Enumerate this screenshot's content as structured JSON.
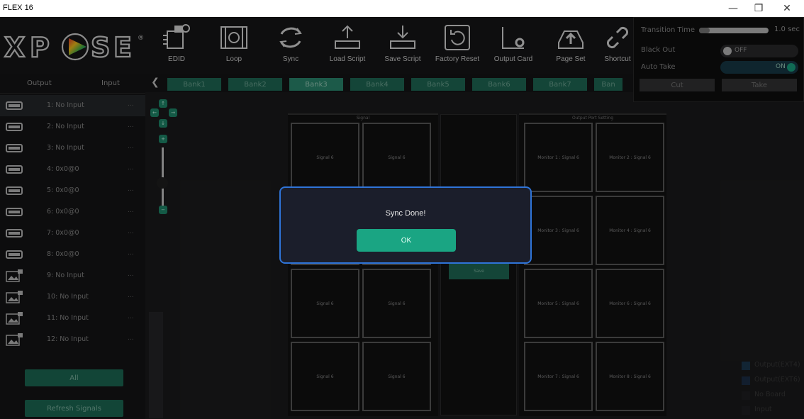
{
  "window": {
    "title": "FLEX 16",
    "minimize": "—",
    "restore": "❐",
    "close": "✕"
  },
  "logo": {
    "text": "XPOSE",
    "mark": "®"
  },
  "toolbar": {
    "items": [
      {
        "label": "EDID",
        "icon": "edid-chip-icon"
      },
      {
        "label": "Loop",
        "icon": "loop-film-icon"
      },
      {
        "label": "Sync",
        "icon": "sync-arrows-icon"
      },
      {
        "label": "Load Script",
        "icon": "load-script-tray-icon"
      },
      {
        "label": "Save Script",
        "icon": "save-script-tray-icon"
      },
      {
        "label": "Factory Reset",
        "icon": "factory-reset-icon"
      },
      {
        "label": "Output Card",
        "icon": "output-card-gear-icon"
      },
      {
        "label": "Page Set",
        "icon": "page-set-upload-icon"
      },
      {
        "label": "Shortcut",
        "icon": "shortcut-link-icon"
      }
    ]
  },
  "control_panel": {
    "transition_time_label": "Transition Time",
    "transition_time_value": "1.0 sec",
    "transition_time_level": 0.15,
    "black_out_label": "Black Out",
    "black_out_state": "OFF",
    "auto_take_label": "Auto Take",
    "auto_take_state": "ON",
    "cut_label": "Cut",
    "take_label": "Take"
  },
  "left_panel": {
    "tabs": [
      "Output",
      "Input"
    ],
    "inputs": [
      {
        "label": "1: No Input",
        "more": "...",
        "icon": "hdmi-port-icon",
        "selected": true
      },
      {
        "label": "2: No Input",
        "more": "...",
        "icon": "hdmi-port-icon"
      },
      {
        "label": "3: No Input",
        "more": "...",
        "icon": "hdmi-port-icon"
      },
      {
        "label": "4: 0x0@0",
        "more": "...",
        "icon": "hdmi-port-icon"
      },
      {
        "label": "5: 0x0@0",
        "more": "...",
        "icon": "hdmi-port-icon"
      },
      {
        "label": "6: 0x0@0",
        "more": "...",
        "icon": "hdmi-port-icon"
      },
      {
        "label": "7: 0x0@0",
        "more": "...",
        "icon": "hdmi-port-icon"
      },
      {
        "label": "8: 0x0@0",
        "more": "...",
        "icon": "hdmi-port-icon"
      },
      {
        "label": "9: No Input",
        "more": "...",
        "icon": "image-input-icon"
      },
      {
        "label": "10: No Input",
        "more": "...",
        "icon": "image-input-icon"
      },
      {
        "label": "11: No Input",
        "more": "...",
        "icon": "image-input-icon"
      },
      {
        "label": "12: No Input",
        "more": "...",
        "icon": "image-input-icon"
      }
    ],
    "all_button": "All",
    "refresh_button": "Refresh Signals"
  },
  "banks": {
    "prev": "❮",
    "items": [
      "Bank1",
      "Bank2",
      "Bank3",
      "Bank4",
      "Bank5",
      "Bank6",
      "Bank7",
      "Ban"
    ],
    "active_index": 2
  },
  "ptz": {
    "up": "↑",
    "left": "←",
    "right": "→",
    "down": "↓",
    "zoom_in": "+",
    "zoom_out": "−"
  },
  "layout": {
    "signal_title": "Signal",
    "output_title": "Output Port Setting",
    "signal_cells": [
      "Signal 6",
      "Signal 6",
      "Signal 6",
      "Signal 6",
      "Signal 6",
      "Signal 6",
      "Signal 6",
      "Signal 6"
    ],
    "output_cells": [
      "Monitor 1 : Signal 6",
      "Monitor 2 : Signal 6",
      "Monitor 3 : Signal 6",
      "Monitor 4 : Signal 6",
      "Monitor 5 : Signal 6",
      "Monitor 6 : Signal 6",
      "Monitor 7 : Signal 6",
      "Monitor 8 : Signal 6"
    ],
    "middle_button": "Save"
  },
  "legend": [
    {
      "label": "Output(EXT4)",
      "color": "#1d3a50"
    },
    {
      "label": "Output(EXT6)",
      "color": "#1d2f48"
    },
    {
      "label": "No Board",
      "color": "#202022"
    },
    {
      "label": "Input",
      "color": "#202022"
    }
  ],
  "dialog": {
    "message": "Sync Done!",
    "ok_label": "OK"
  },
  "colors": {
    "accent": "#1aa583",
    "dialog_border": "#2f74d8",
    "bank": "#1f6b56"
  }
}
